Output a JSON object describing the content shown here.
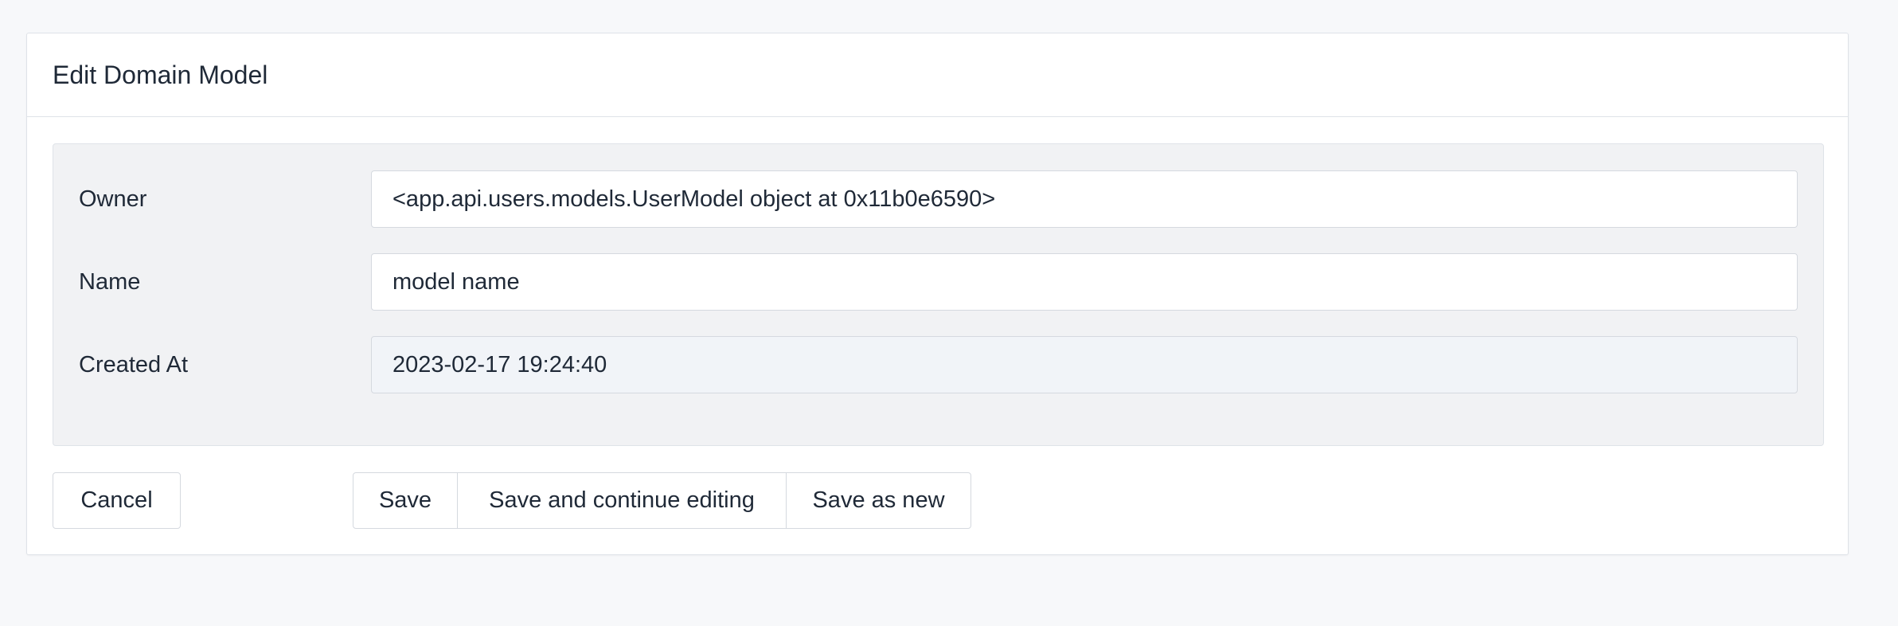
{
  "card": {
    "title": "Edit Domain Model"
  },
  "form": {
    "owner": {
      "label": "Owner",
      "value": "<app.api.users.models.UserModel object at 0x11b0e6590>"
    },
    "name": {
      "label": "Name",
      "value": "model name"
    },
    "created_at": {
      "label": "Created At",
      "value": "2023-02-17 19:24:40"
    }
  },
  "actions": {
    "cancel_label": "Cancel",
    "save_label": "Save",
    "save_continue_label": "Save and continue editing",
    "save_new_label": "Save as new"
  },
  "colors": {
    "page_background": "#f7f8fa",
    "card_background": "#ffffff",
    "fieldset_background": "#f1f2f4",
    "readonly_field_background": "#f1f4f8",
    "border": "#d5d9df",
    "text": "#1f2937"
  }
}
